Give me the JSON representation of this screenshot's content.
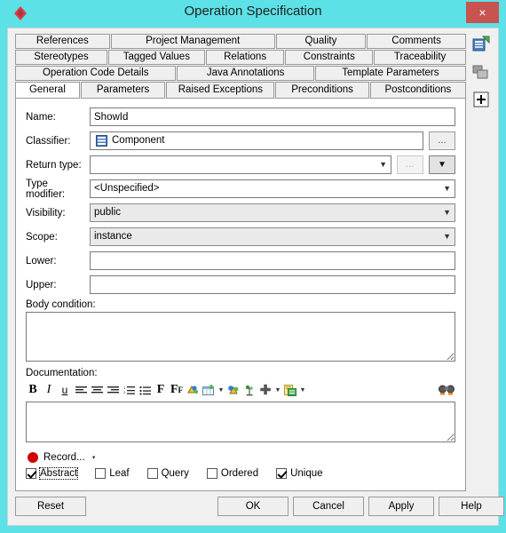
{
  "window": {
    "title": "Operation Specification",
    "logo_icon": "red-diamond-logo",
    "close_label": "×"
  },
  "tabs": {
    "row1": [
      {
        "label": "References"
      },
      {
        "label": "Project Management"
      },
      {
        "label": "Quality"
      },
      {
        "label": "Comments"
      }
    ],
    "row2": [
      {
        "label": "Stereotypes"
      },
      {
        "label": "Tagged Values"
      },
      {
        "label": "Relations"
      },
      {
        "label": "Constraints"
      },
      {
        "label": "Traceability"
      }
    ],
    "row3": [
      {
        "label": "Operation Code Details"
      },
      {
        "label": "Java Annotations"
      },
      {
        "label": "Template Parameters"
      }
    ],
    "row4": [
      {
        "label": "General",
        "active": true
      },
      {
        "label": "Parameters"
      },
      {
        "label": "Raised Exceptions"
      },
      {
        "label": "Preconditions"
      },
      {
        "label": "Postconditions"
      }
    ]
  },
  "form": {
    "name_label": "Name:",
    "name_value": "ShowId",
    "classifier_label": "Classifier:",
    "classifier_value": "Component",
    "classifier_browse": "...",
    "return_type_label": "Return type:",
    "return_type_value": "",
    "return_type_browse": "...",
    "type_modifier_label": "Type modifier:",
    "type_modifier_value": "<Unspecified>",
    "visibility_label": "Visibility:",
    "visibility_value": "public",
    "scope_label": "Scope:",
    "scope_value": "instance",
    "lower_label": "Lower:",
    "lower_value": "",
    "upper_label": "Upper:",
    "upper_value": "",
    "body_condition_label": "Body condition:",
    "body_condition_value": "",
    "documentation_label": "Documentation:",
    "documentation_value": ""
  },
  "rtf_toolbar": [
    {
      "name": "bold-icon",
      "glyph": "B"
    },
    {
      "name": "italic-icon",
      "glyph": "I"
    },
    {
      "name": "underline-icon",
      "glyph": "u"
    },
    {
      "name": "align-left-icon",
      "glyph": "≡"
    },
    {
      "name": "align-center-icon",
      "glyph": "≡"
    },
    {
      "name": "align-right-icon",
      "glyph": "≡"
    },
    {
      "name": "ordered-list-icon",
      "glyph": "☰"
    },
    {
      "name": "unordered-list-icon",
      "glyph": "☰"
    },
    {
      "name": "font-icon",
      "glyph": "F"
    },
    {
      "name": "font-size-icon",
      "glyph": "F"
    },
    {
      "name": "text-color-icon",
      "glyph": "◑"
    },
    {
      "name": "insert-table-icon",
      "glyph": "▦"
    },
    {
      "name": "insert-image-icon",
      "glyph": "◑"
    },
    {
      "name": "insert-symbol-icon",
      "glyph": "⚘"
    },
    {
      "name": "add-icon",
      "glyph": "✚"
    },
    {
      "name": "paste-icon",
      "glyph": "▤"
    },
    {
      "name": "find-icon",
      "glyph": "⚲"
    }
  ],
  "record": {
    "label": "Record...",
    "dot_icon": "record-dot-icon",
    "caret": "▾"
  },
  "checkboxes": [
    {
      "label": "Abstract",
      "checked": true,
      "focused": true
    },
    {
      "label": "Leaf",
      "checked": false,
      "focused": false
    },
    {
      "label": "Query",
      "checked": false,
      "focused": false
    },
    {
      "label": "Ordered",
      "checked": false,
      "focused": false
    },
    {
      "label": "Unique",
      "checked": true,
      "focused": false
    }
  ],
  "footer": {
    "reset": "Reset",
    "ok": "OK",
    "cancel": "Cancel",
    "apply": "Apply",
    "help": "Help"
  },
  "rail": [
    {
      "name": "add-property-icon"
    },
    {
      "name": "copy-element-icon"
    },
    {
      "name": "expand-icon"
    }
  ],
  "colors": {
    "title_bar": "#5ce1e6",
    "close_button": "#c75450",
    "accent": "#3465a4"
  }
}
